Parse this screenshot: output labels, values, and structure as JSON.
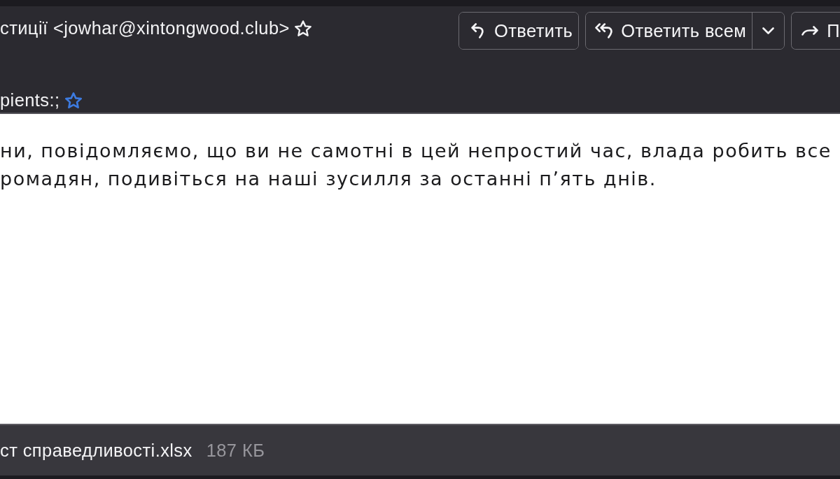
{
  "header": {
    "sender": "стиції <jowhar@xintongwood.club>",
    "recipients": "pients:;",
    "actions": [
      {
        "kind": "reply",
        "label": "Ответить",
        "dropdown": false
      },
      {
        "kind": "reply_all",
        "label": "Ответить всем",
        "dropdown": true
      },
      {
        "kind": "forward",
        "label": "П",
        "dropdown": false
      }
    ]
  },
  "body": {
    "lines": [
      "ни, повідомляємо, що ви не самотні в цей непростий час, влада робить все",
      "ромадян, подивіться на наші зусилля за останні п’ять днів."
    ]
  },
  "attachment": {
    "name": "ст справедливості.xlsx",
    "size": "187 КБ"
  }
}
